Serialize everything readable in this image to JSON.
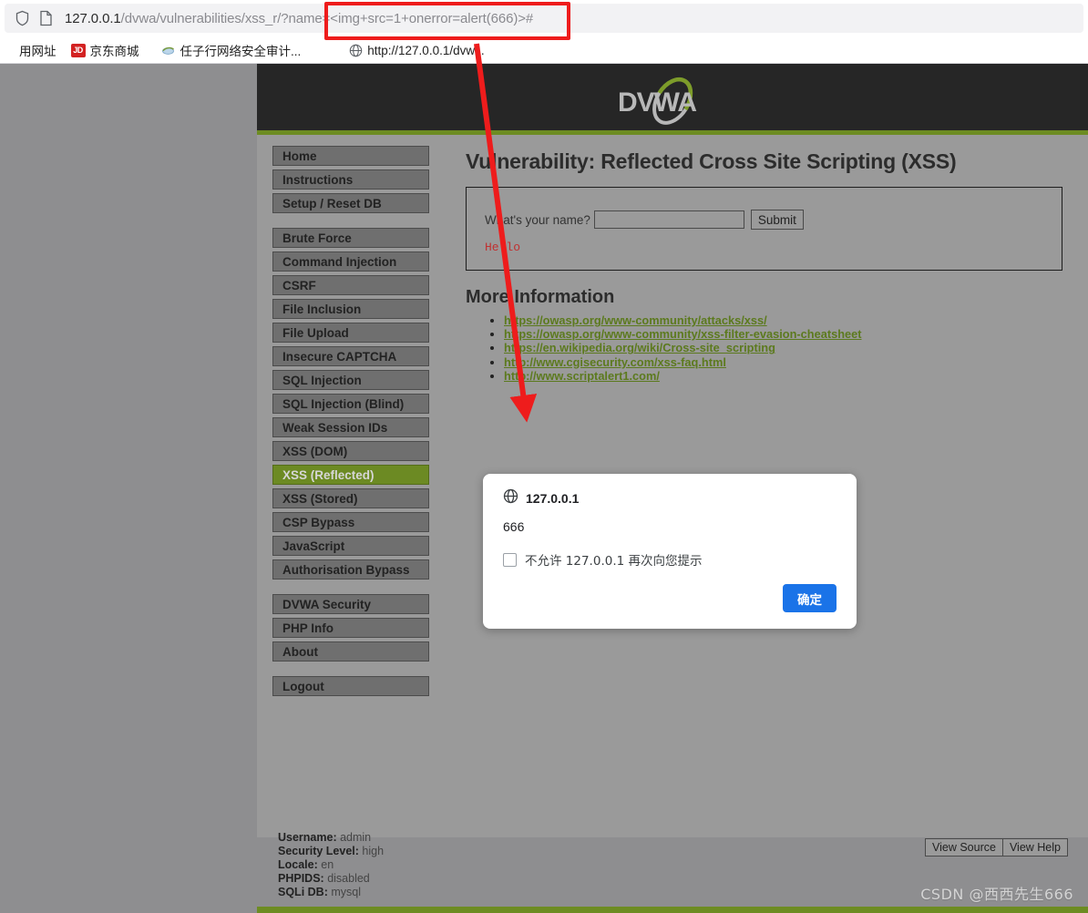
{
  "browser": {
    "url_host": "127.0.0.1",
    "url_path": "/dvwa/vulnerabilities/xss_r/?name=",
    "url_payload": "<img+src=1+onerror=alert(666)>#",
    "shield_icon": "shield-icon",
    "page_icon": "page-icon",
    "bookmarks": [
      {
        "label": "用网址",
        "icon": "globe-icon"
      },
      {
        "label": "京东商城",
        "icon": "jd-icon"
      },
      {
        "label": "任子行网络安全审计...",
        "icon": "leaf-icon"
      },
      {
        "label": "http://127.0.0.1/dvw...",
        "icon": "globe-icon"
      }
    ]
  },
  "site": {
    "logo_text": "DVWA",
    "accent_green": "#6d8c22",
    "header_dark": "#262626",
    "body_gray": "#9a9a9a"
  },
  "sidebar": {
    "groups": [
      {
        "items": [
          {
            "label": "Home",
            "selected": false
          },
          {
            "label": "Instructions",
            "selected": false
          },
          {
            "label": "Setup / Reset DB",
            "selected": false
          }
        ]
      },
      {
        "items": [
          {
            "label": "Brute Force",
            "selected": false
          },
          {
            "label": "Command Injection",
            "selected": false
          },
          {
            "label": "CSRF",
            "selected": false
          },
          {
            "label": "File Inclusion",
            "selected": false
          },
          {
            "label": "File Upload",
            "selected": false
          },
          {
            "label": "Insecure CAPTCHA",
            "selected": false
          },
          {
            "label": "SQL Injection",
            "selected": false
          },
          {
            "label": "SQL Injection (Blind)",
            "selected": false
          },
          {
            "label": "Weak Session IDs",
            "selected": false
          },
          {
            "label": "XSS (DOM)",
            "selected": false
          },
          {
            "label": "XSS (Reflected)",
            "selected": true
          },
          {
            "label": "XSS (Stored)",
            "selected": false
          },
          {
            "label": "CSP Bypass",
            "selected": false
          },
          {
            "label": "JavaScript",
            "selected": false
          },
          {
            "label": "Authorisation Bypass",
            "selected": false
          }
        ]
      },
      {
        "items": [
          {
            "label": "DVWA Security",
            "selected": false
          },
          {
            "label": "PHP Info",
            "selected": false
          },
          {
            "label": "About",
            "selected": false
          }
        ]
      },
      {
        "items": [
          {
            "label": "Logout",
            "selected": false
          }
        ]
      }
    ],
    "user_info": [
      {
        "key": "Username:",
        "value": "admin"
      },
      {
        "key": "Security Level:",
        "value": "high"
      },
      {
        "key": "Locale:",
        "value": "en"
      },
      {
        "key": "PHPIDS:",
        "value": "disabled"
      },
      {
        "key": "SQLi DB:",
        "value": "mysql"
      }
    ]
  },
  "main": {
    "title": "Vulnerability: Reflected Cross Site Scripting (XSS)",
    "form": {
      "label": "What's your name?",
      "input_value": "",
      "input_placeholder": "",
      "submit_label": "Submit"
    },
    "result_text": "Hello",
    "more_info_title": "More Information",
    "links": [
      "https://owasp.org/www-community/attacks/xss/",
      "https://owasp.org/www-community/xss-filter-evasion-cheatsheet",
      "https://en.wikipedia.org/wiki/Cross-site_scripting",
      "http://www.cgisecurity.com/xss-faq.html",
      "http://www.scriptalert1.com/"
    ],
    "view_source_label": "View Source",
    "view_help_label": "View Help"
  },
  "dialog": {
    "origin": "127.0.0.1",
    "origin_icon": "globe-icon",
    "message": "666",
    "checkbox_label": "不允许 127.0.0.1 再次向您提示",
    "checkbox_checked": false,
    "ok_label": "确定",
    "ok_color": "#1a73e8"
  },
  "watermark": "CSDN @西西先生666",
  "annotations": {
    "highlight_color": "#ee1c1c",
    "highlight_target": "<img+src=1+onerror=alert(666)>#"
  }
}
